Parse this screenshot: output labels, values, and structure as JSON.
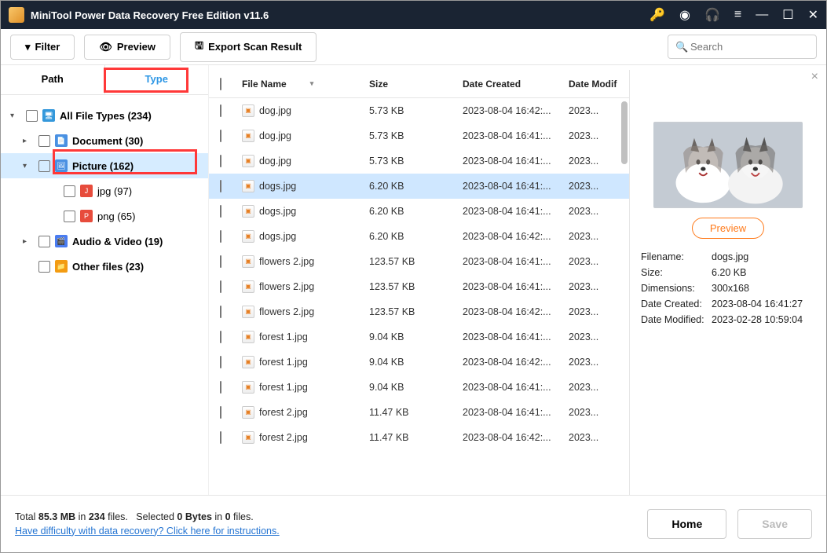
{
  "window": {
    "title": "MiniTool Power Data Recovery Free Edition v11.6"
  },
  "toolbar": {
    "filter": "Filter",
    "preview": "Preview",
    "export": "Export Scan Result",
    "search_placeholder": "Search"
  },
  "side_tabs": {
    "path": "Path",
    "type": "Type"
  },
  "tree": {
    "all": "All File Types (234)",
    "document": "Document (30)",
    "picture": "Picture (162)",
    "jpg": "jpg (97)",
    "png": "png (65)",
    "audio": "Audio & Video (19)",
    "other": "Other files (23)"
  },
  "columns": {
    "name": "File Name",
    "size": "Size",
    "date": "Date Created",
    "mod": "Date Modif"
  },
  "files": [
    {
      "name": "dog.jpg",
      "size": "5.73 KB",
      "date": "2023-08-04 16:42:...",
      "mod": "2023..."
    },
    {
      "name": "dog.jpg",
      "size": "5.73 KB",
      "date": "2023-08-04 16:41:...",
      "mod": "2023..."
    },
    {
      "name": "dog.jpg",
      "size": "5.73 KB",
      "date": "2023-08-04 16:41:...",
      "mod": "2023..."
    },
    {
      "name": "dogs.jpg",
      "size": "6.20 KB",
      "date": "2023-08-04 16:41:...",
      "mod": "2023...",
      "selected": true
    },
    {
      "name": "dogs.jpg",
      "size": "6.20 KB",
      "date": "2023-08-04 16:41:...",
      "mod": "2023..."
    },
    {
      "name": "dogs.jpg",
      "size": "6.20 KB",
      "date": "2023-08-04 16:42:...",
      "mod": "2023..."
    },
    {
      "name": "flowers 2.jpg",
      "size": "123.57 KB",
      "date": "2023-08-04 16:41:...",
      "mod": "2023..."
    },
    {
      "name": "flowers 2.jpg",
      "size": "123.57 KB",
      "date": "2023-08-04 16:41:...",
      "mod": "2023..."
    },
    {
      "name": "flowers 2.jpg",
      "size": "123.57 KB",
      "date": "2023-08-04 16:42:...",
      "mod": "2023..."
    },
    {
      "name": "forest 1.jpg",
      "size": "9.04 KB",
      "date": "2023-08-04 16:41:...",
      "mod": "2023..."
    },
    {
      "name": "forest 1.jpg",
      "size": "9.04 KB",
      "date": "2023-08-04 16:42:...",
      "mod": "2023..."
    },
    {
      "name": "forest 1.jpg",
      "size": "9.04 KB",
      "date": "2023-08-04 16:41:...",
      "mod": "2023..."
    },
    {
      "name": "forest 2.jpg",
      "size": "11.47 KB",
      "date": "2023-08-04 16:41:...",
      "mod": "2023..."
    },
    {
      "name": "forest 2.jpg",
      "size": "11.47 KB",
      "date": "2023-08-04 16:42:...",
      "mod": "2023..."
    }
  ],
  "preview": {
    "button": "Preview",
    "filename_label": "Filename:",
    "filename": "dogs.jpg",
    "size_label": "Size:",
    "size": "6.20 KB",
    "dimensions_label": "Dimensions:",
    "dimensions": "300x168",
    "created_label": "Date Created:",
    "created": "2023-08-04 16:41:27",
    "modified_label": "Date Modified:",
    "modified": "2023-02-28 10:59:04"
  },
  "footer": {
    "total_prefix": "Total ",
    "total_size": "85.3 MB",
    "total_in": " in ",
    "total_count": "234",
    "total_files": " files.",
    "sel_prefix": "Selected ",
    "sel_bytes": "0 Bytes",
    "sel_in": " in ",
    "sel_count": "0",
    "sel_files": " files.",
    "help": "Have difficulty with data recovery? Click here for instructions.",
    "home": "Home",
    "save": "Save"
  }
}
